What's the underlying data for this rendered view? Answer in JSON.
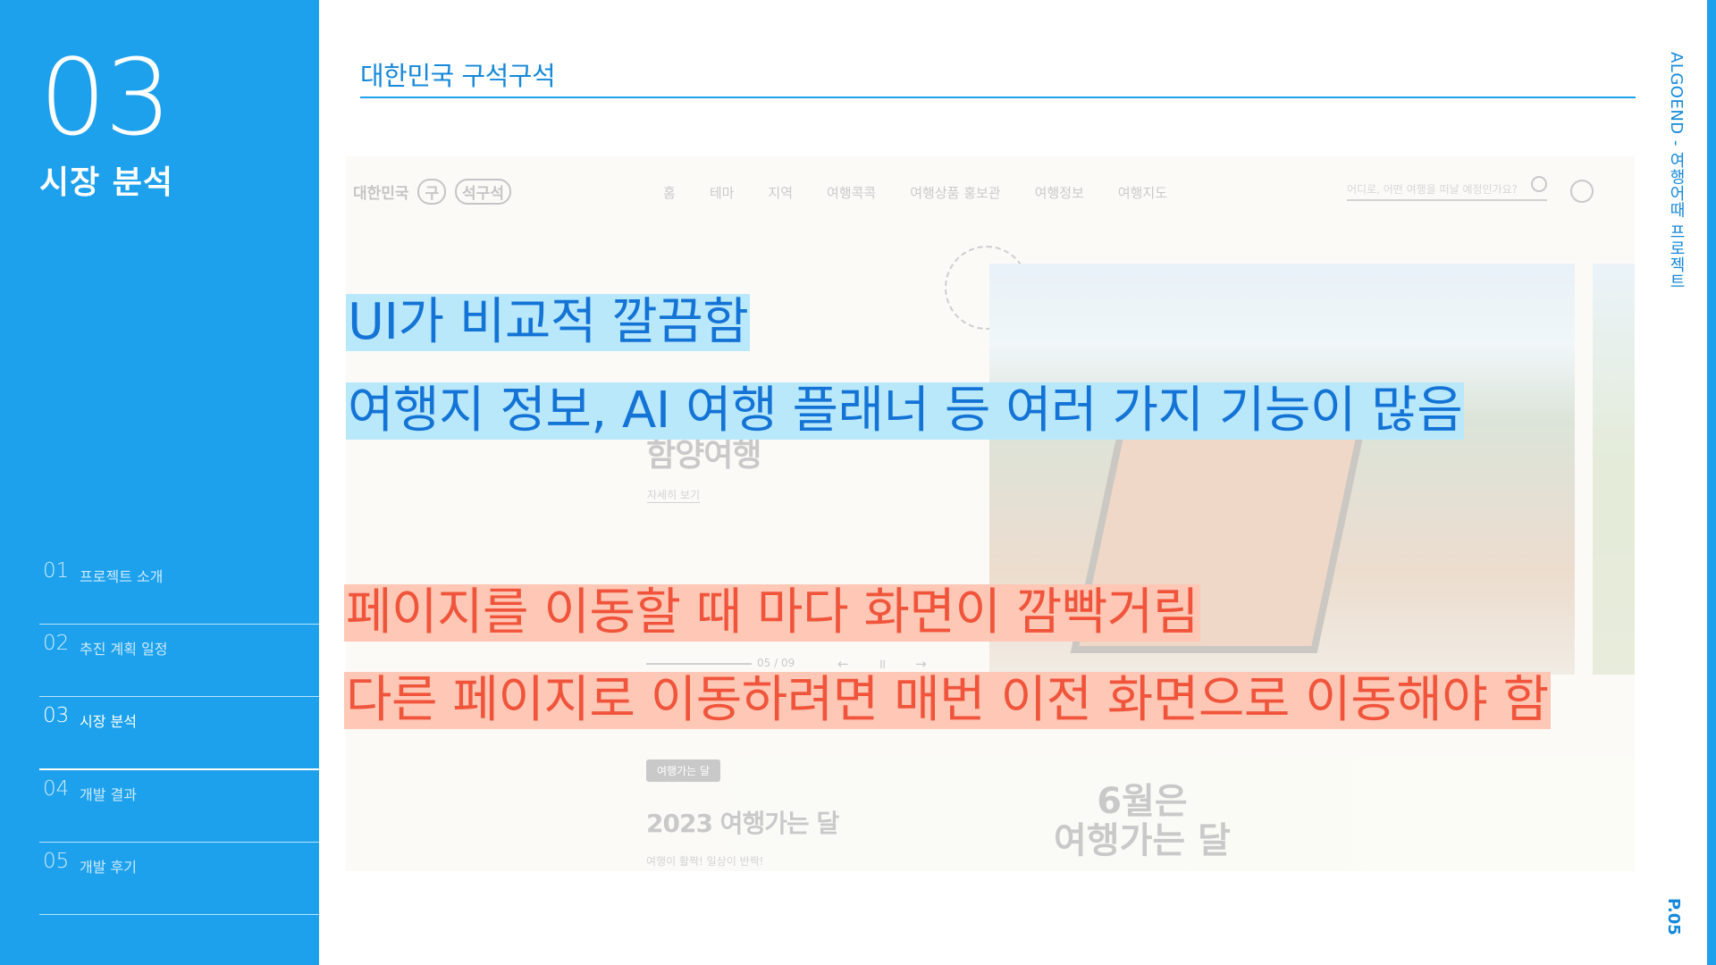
{
  "sidebar": {
    "section_number": "03",
    "section_title": "시장 분석",
    "nav": [
      {
        "num": "01",
        "label": "프로젝트 소개"
      },
      {
        "num": "02",
        "label": "추진 계획 일정"
      },
      {
        "num": "03",
        "label": "시장 분석"
      },
      {
        "num": "04",
        "label": "개발 결과"
      },
      {
        "num": "05",
        "label": "개발 후기"
      }
    ],
    "active_index": 2
  },
  "header": {
    "title": "대한민국 구석구석"
  },
  "vertical_title": "ALGOEND - 여행어때 프로젝트",
  "page_number": "P.05",
  "screenshot": {
    "logo_text": "대한민국",
    "logo_mark_1": "구",
    "logo_mark_2": "석구석",
    "menu": [
      "홈",
      "테마",
      "지역",
      "여행콕콕",
      "여행상품 홍보관",
      "여행정보",
      "여행지도"
    ],
    "search_placeholder": "어디로, 어떤 여행을 떠날 예정인가요?",
    "hero_heading": "함양여행",
    "hero_link": "자세히 보기",
    "slider_count": "05 / 09",
    "slider_controls": "← ॥ →",
    "band_badge": "여행가는 달",
    "band_title": "2023 여행가는 달",
    "band_sub": "여행이 활짝! 일상이 반짝!",
    "band_promo_line1": "6월은",
    "band_promo_line2": "여행가는 달"
  },
  "annotations": {
    "positive_1": "UI가 비교적 깔끔함",
    "positive_2": "여행지 정보, AI 여행 플래너 등 여러 가지 기능이 많음",
    "negative_1": "페이지를 이동할 때 마다 화면이 깜빡거림",
    "negative_2": "다른 페이지로 이동하려면 매번 이전 화면으로 이동해야 함"
  },
  "colors": {
    "accent": "#1da1ec",
    "positive_highlight": "#bae8fb",
    "positive_text": "#1474d6",
    "negative_highlight": "#ffc7b6",
    "negative_text": "#f0553c"
  }
}
